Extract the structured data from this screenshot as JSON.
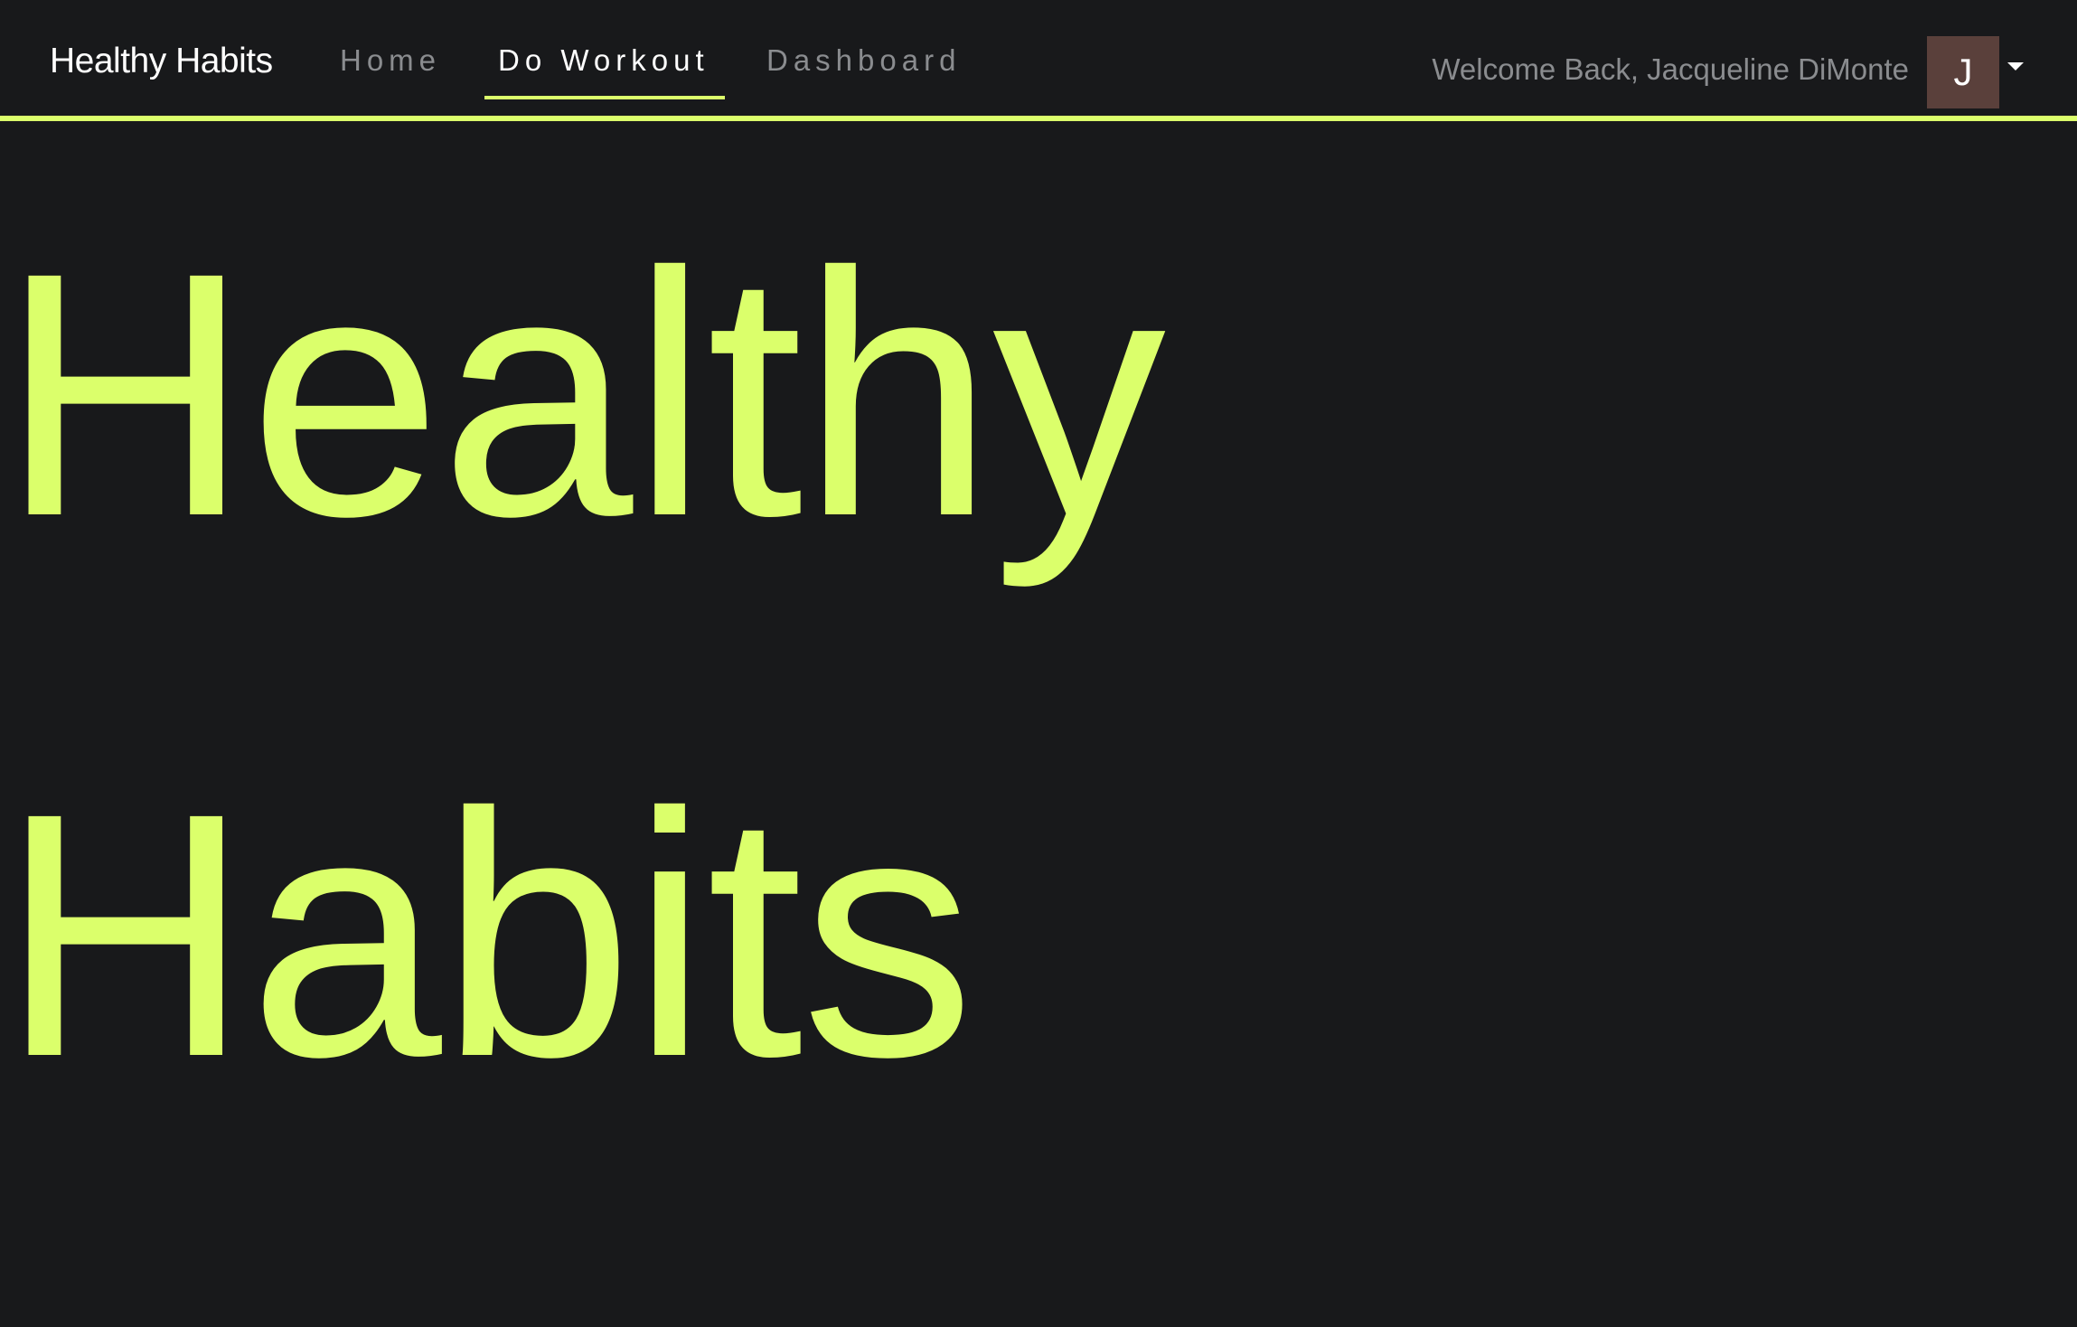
{
  "navbar": {
    "brand": "Healthy Habits",
    "links": [
      {
        "label": "Home",
        "active": false
      },
      {
        "label": "Do Workout",
        "active": true
      },
      {
        "label": "Dashboard",
        "active": false
      }
    ],
    "welcome_text": "Welcome Back, Jacqueline DiMonte",
    "avatar_initial": "J",
    "accent_color": "#dbff6b"
  },
  "hero": {
    "line1": "Healthy",
    "line2": "Habits"
  },
  "icons": {
    "dropdown": "caret-down-icon"
  }
}
